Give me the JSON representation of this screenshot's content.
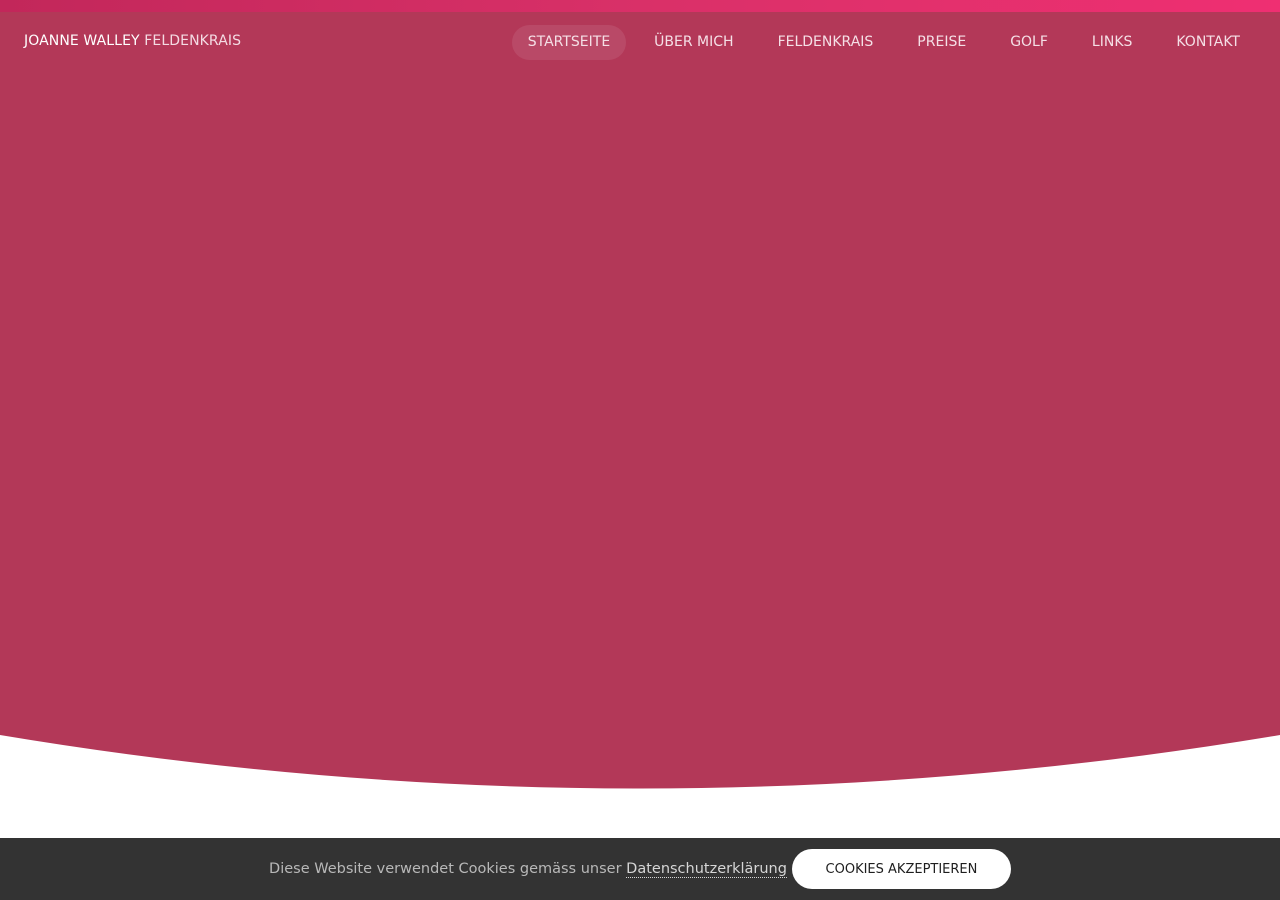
{
  "header": {
    "brand_name": "JOANNE WALLEY",
    "brand_suffix": "FELDENKRAIS"
  },
  "nav": {
    "items": [
      {
        "label": "STARTSEITE",
        "active": true
      },
      {
        "label": "ÜBER MICH"
      },
      {
        "label": "FELDENKRAIS"
      },
      {
        "label": "PREISE"
      },
      {
        "label": "GOLF"
      },
      {
        "label": "LINKS"
      },
      {
        "label": "KONTAKT"
      }
    ]
  },
  "cookie": {
    "text": "Diese Website verwendet Cookies gemäss unser",
    "link_label": "Datenschutzerklärung",
    "button_label": "COOKIES AKZEPTIEREN"
  },
  "colors": {
    "hero_bg": "#b33858",
    "stripe_start": "#c2275a",
    "stripe_end": "#ef2f72",
    "cookie_bar": "#333333"
  }
}
